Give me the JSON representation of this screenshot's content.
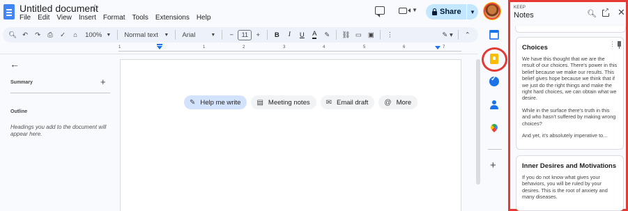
{
  "document": {
    "title": "Untitled document",
    "menu": [
      "File",
      "Edit",
      "View",
      "Insert",
      "Format",
      "Tools",
      "Extensions",
      "Help"
    ],
    "share_label": "Share"
  },
  "toolbar": {
    "zoom": "100%",
    "style": "Normal text",
    "font": "Arial",
    "font_size": "11",
    "bold": "B",
    "italic": "I",
    "underline": "U",
    "text_color": "A"
  },
  "ruler": {
    "labels": [
      "1",
      "1",
      "2",
      "3",
      "4",
      "5",
      "6",
      "7"
    ]
  },
  "outline_panel": {
    "summary_label": "Summary",
    "outline_label": "Outline",
    "hint": "Headings you add to the document will appear here."
  },
  "chips": [
    {
      "label": "Help me write",
      "icon": "pen-sparkle-icon"
    },
    {
      "label": "Meeting notes",
      "icon": "document-icon"
    },
    {
      "label": "Email draft",
      "icon": "email-icon"
    },
    {
      "label": "More",
      "icon": "at-icon"
    }
  ],
  "keep": {
    "brand": "KEEP",
    "title": "Notes",
    "notes": [
      {
        "title": "Choices",
        "paragraphs": [
          "We have this thought that we are the result of our choices. There's power in this belief because we make our results. This belief gives hope because we think that if we just do the right things and make the right hard choices, we can obtain what we desire.",
          "While in the surface there's truth in this and who hasn't suffered by making wrong choices?",
          "And yet, it's absolutely imperative to..."
        ]
      },
      {
        "title": "Inner Desires and Motivations",
        "paragraphs": [
          "If you do not know what gives your behaviors, you will be ruled by your desires.  This is the root of anxiety and many diseases."
        ]
      }
    ]
  },
  "colors": {
    "accent": "#1a73e8",
    "share_bg": "#c2e7ff",
    "highlight_ring": "#e53935",
    "keep_yellow": "#fbbc04"
  }
}
